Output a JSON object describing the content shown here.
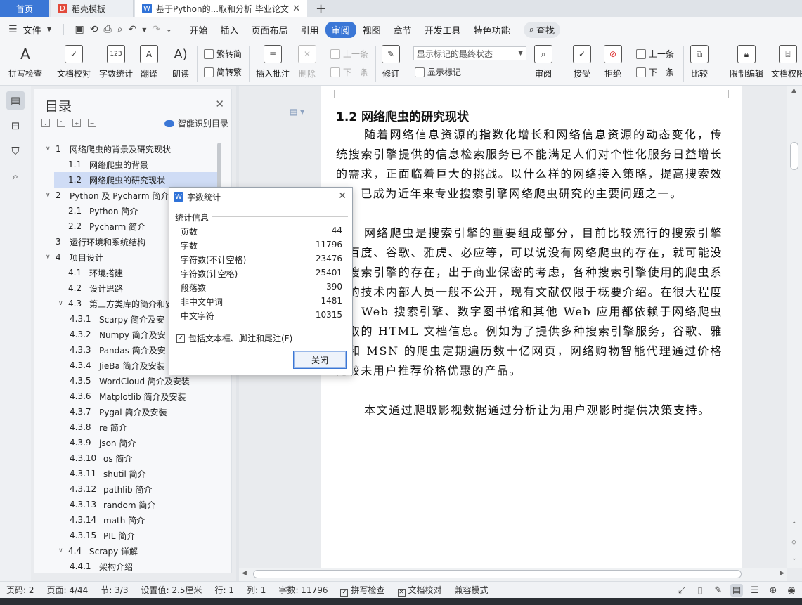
{
  "tabs": {
    "home": "首页",
    "templates": "稻壳模板",
    "document": "基于Python的...取和分析 毕业论文",
    "new_tab": "+"
  },
  "menu": {
    "file": "文件",
    "items": [
      "开始",
      "插入",
      "页面布局",
      "引用",
      "审阅",
      "视图",
      "章节",
      "开发工具",
      "特色功能"
    ],
    "active": "审阅",
    "search": "查找"
  },
  "ribbon": {
    "spellcheck": "拼写检查",
    "doc_proof": "文档校对",
    "word_count": "字数统计",
    "translate": "翻译",
    "read_aloud": "朗读",
    "trad_to_simp": "繁转简",
    "simp_to_trad": "简转繁",
    "insert_comment": "插入批注",
    "delete": "删除",
    "prev_comment": "上一条",
    "next_comment": "下一条",
    "revise": "修订",
    "show_markup_state": "显示标记的最终状态",
    "show_markup": "显示标记",
    "review": "审阅",
    "accept": "接受",
    "reject": "拒绝",
    "prev_change": "上一条",
    "next_change": "下一条",
    "compare": "比较",
    "restrict_edit": "限制编辑",
    "doc_rights": "文档权限"
  },
  "toc": {
    "title": "目录",
    "smart_toc": "智能识别目录",
    "items": [
      {
        "num": "1",
        "text": "网络爬虫的背景及研究现状",
        "level": 1,
        "expanded": true
      },
      {
        "num": "1.1",
        "text": "网络爬虫的背景",
        "level": 2
      },
      {
        "num": "1.2",
        "text": "网络爬虫的研究现状",
        "level": 2,
        "selected": true
      },
      {
        "num": "2",
        "text": "Python 及 Pycharm 简介",
        "level": 1,
        "expanded": true
      },
      {
        "num": "2.1",
        "text": "Python 简介",
        "level": 2
      },
      {
        "num": "2.2",
        "text": "Pycharm 简介",
        "level": 2
      },
      {
        "num": "3",
        "text": "运行环境和系统结构",
        "level": 1
      },
      {
        "num": "4",
        "text": "项目设计",
        "level": 1,
        "expanded": true
      },
      {
        "num": "4.1",
        "text": "环境搭建",
        "level": 2
      },
      {
        "num": "4.2",
        "text": "设计思路",
        "level": 2
      },
      {
        "num": "4.3",
        "text": "第三方类库的简介和安",
        "level": 2,
        "expanded": true
      },
      {
        "num": "4.3.1",
        "text": "Scarpy 简介及安",
        "level": 3
      },
      {
        "num": "4.3.2",
        "text": "Numpy 简介及安",
        "level": 3
      },
      {
        "num": "4.3.3",
        "text": "Pandas 简介及安",
        "level": 3
      },
      {
        "num": "4.3.4",
        "text": "JieBa 简介及安装",
        "level": 3
      },
      {
        "num": "4.3.5",
        "text": "WordCloud 简介及安装",
        "level": 3
      },
      {
        "num": "4.3.6",
        "text": "Matplotlib 简介及安装",
        "level": 3
      },
      {
        "num": "4.3.7",
        "text": "Pygal 简介及安装",
        "level": 3
      },
      {
        "num": "4.3.8",
        "text": "re 简介",
        "level": 3
      },
      {
        "num": "4.3.9",
        "text": "json 简介",
        "level": 3
      },
      {
        "num": "4.3.10",
        "text": "os 简介",
        "level": 3
      },
      {
        "num": "4.3.11",
        "text": "shutil 简介",
        "level": 3
      },
      {
        "num": "4.3.12",
        "text": "pathlib 简介",
        "level": 3
      },
      {
        "num": "4.3.13",
        "text": "random 简介",
        "level": 3
      },
      {
        "num": "4.3.14",
        "text": "math 简介",
        "level": 3
      },
      {
        "num": "4.3.15",
        "text": "PIL 简介",
        "level": 3
      },
      {
        "num": "4.4",
        "text": "Scrapy 详解",
        "level": 2,
        "expanded": true
      },
      {
        "num": "4.4.1",
        "text": "架构介绍",
        "level": 3
      }
    ]
  },
  "document": {
    "heading": "1.2   网络爬虫的研究现状",
    "paragraphs": [
      "随着网络信息资源的指数化增长和网络信息资源的动态变化，传统搜索引擎提供的信息检索服务已不能满足人们对个性化服务日益增长的需求，正面临着巨大的挑战。以什么样的网络接入策略，提高搜索效率，已成为近年来专业搜索引擎网络爬虫研究的主要问题之一。",
      "网络爬虫是搜索引擎的重要组成部分，目前比较流行的搜索引擎有百度、谷歌、雅虎、必应等，可以说没有网络爬虫的存在，就可能没有搜索引擎的存在，出于商业保密的考虑，各种搜索引擎使用的爬虫系统的技术内部人员一般不公开，现有文献仅限于概要介绍。在很大程度上，Web 搜索引擎、数字图书馆和其他 Web 应用都依赖于网络爬虫获取的 HTML 文档信息。例如为了提供多种搜索引擎服务，谷歌、雅虎和 MSN 的爬虫定期遍历数十亿网页，网络购物智能代理通过价格比较未用户推荐价格优惠的产品。",
      "本文通过爬取影视数据通过分析让为用户观影时提供决策支持。"
    ]
  },
  "dialog": {
    "title": "字数统计",
    "group": "统计信息",
    "stats": [
      {
        "label": "页数",
        "value": "44"
      },
      {
        "label": "字数",
        "value": "11796"
      },
      {
        "label": "字符数(不计空格)",
        "value": "23476"
      },
      {
        "label": "字符数(计空格)",
        "value": "25401"
      },
      {
        "label": "段落数",
        "value": "390"
      },
      {
        "label": "非中文单词",
        "value": "1481"
      },
      {
        "label": "中文字符",
        "value": "10315"
      }
    ],
    "include_label": "包括文本框、脚注和尾注(F)",
    "include_checked": true,
    "close_button": "关闭"
  },
  "status": {
    "page_code": "页码: 2",
    "page": "页面: 4/44",
    "section": "节: 3/3",
    "setting": "设置值: 2.5厘米",
    "row": "行: 1",
    "col": "列: 1",
    "word_count": "字数: 11796",
    "spellcheck": "拼写检查",
    "doc_proof": "文档校对",
    "compat_mode": "兼容模式"
  }
}
